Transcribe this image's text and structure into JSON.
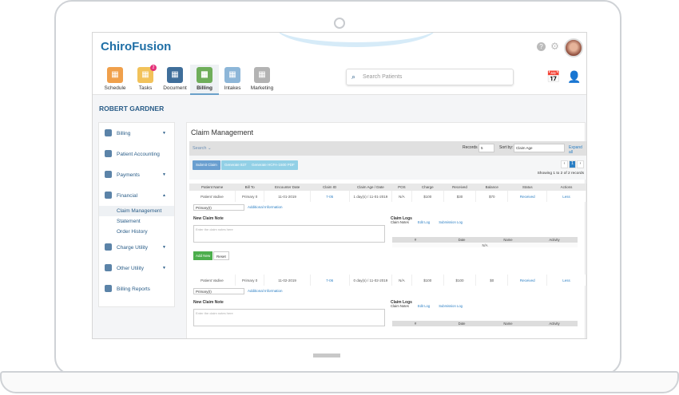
{
  "app": {
    "logo": "ChiroFusion",
    "patient": "ROBERT GARDNER"
  },
  "nav": [
    {
      "label": "Schedule",
      "icon": "calendar-icon",
      "color": "#f0a04b"
    },
    {
      "label": "Tasks",
      "icon": "tasks-icon",
      "color": "#f2c25a",
      "badge": "2"
    },
    {
      "label": "Document",
      "icon": "document-icon",
      "color": "#3f6e9a"
    },
    {
      "label": "Billing",
      "icon": "dollar-icon",
      "color": "#6fae5a",
      "active": true
    },
    {
      "label": "Intakes",
      "icon": "intakes-icon",
      "color": "#8db6d8"
    },
    {
      "label": "Marketing",
      "icon": "globe-icon",
      "color": "#b3b3b3"
    }
  ],
  "search": {
    "placeholder": "Search Patients"
  },
  "sidebar": {
    "items": [
      {
        "label": "Billing"
      },
      {
        "label": "Patient Accounting"
      },
      {
        "label": "Payments"
      },
      {
        "label": "Financial"
      },
      {
        "label": "Charge Utility"
      },
      {
        "label": "Other Utility"
      },
      {
        "label": "Billing Reports"
      }
    ],
    "sub": [
      "Claim Management",
      "Statement",
      "Order History"
    ]
  },
  "main": {
    "title": "Claim Management",
    "search": "Search",
    "records_label": "Records",
    "records": "5",
    "sort_label": "Sort by:",
    "sort": "Claim Age",
    "expand": "Expand all",
    "buttons": [
      "Submit Claim",
      "Generate 837",
      "Generate HCFA-1500 PDF"
    ],
    "page": "1",
    "showing": "Showing 1 to 2 of 2 records",
    "columns": [
      "Patient Name",
      "Bill To",
      "Encounter Date",
      "Claim ID",
      "Claim Age / Date",
      "POS",
      "Charge",
      "Received",
      "Balance",
      "Status",
      "Actions"
    ],
    "rows": [
      {
        "cells": [
          "Patient Vadive",
          "Primary 0",
          "11-01-2019",
          "7-05",
          "1 day(s) / 11-01-2019",
          "N/A",
          "$100",
          "$30",
          "$70",
          "Received",
          "Less"
        ]
      },
      {
        "cells": [
          "Patient Vadive",
          "Primary 0",
          "11-02-2019",
          "7-06",
          "0 day(s) / 11-02-2019",
          "N/A",
          "$100",
          "$100",
          "$0",
          "Received",
          "Less"
        ]
      }
    ],
    "detail": {
      "select": "Primary(I)",
      "additional": "Additional Information",
      "note_title": "New Claim Note",
      "note_placeholder": "Enter the claim notes here",
      "add": "Add New",
      "reset": "Reset",
      "logs_title": "Claim Logs",
      "tabs": [
        "Claim Notes",
        "Edit Log",
        "Submission Log"
      ],
      "log_cols": [
        "#",
        "Date",
        "Name",
        "Activity"
      ],
      "empty": "N/A"
    }
  }
}
